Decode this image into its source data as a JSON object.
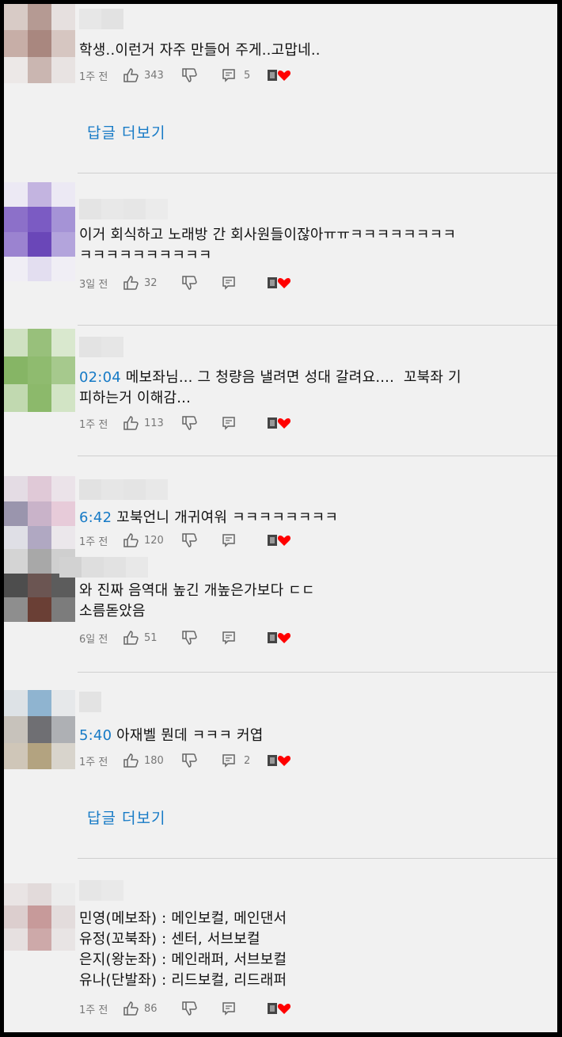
{
  "comments": [
    {
      "text": "학생..이런거 자주 만들어 주게..고맙네..",
      "time": "1주 전",
      "likes": "343",
      "replies": "5",
      "more_replies": "답글 더보기"
    },
    {
      "text": "이거 회식하고 노래방 간 회사원들이잖아ㅠㅠㅋㅋㅋㅋㅋㅋㅋㅋ\nㅋㅋㅋㅋㅋㅋㅋㅋㅋㅋ",
      "time": "3일 전",
      "likes": "32"
    },
    {
      "timestamp": "02:04",
      "text": " 메보좌님... 그 청량음 낼려면 성대 갈려요....  꼬북좌 기\n피하는거 이해감...",
      "time": "1주 전",
      "likes": "113"
    },
    {
      "timestamp": "6:42",
      "text": " 꼬북언니 개귀여워 ㅋㅋㅋㅋㅋㅋㅋㅋ",
      "time": "1주 전",
      "likes": "120"
    },
    {
      "text": "와 진짜 음역대 높긴 개높은가보다 ㄷㄷ\n소름돋았음",
      "time": "6일 전",
      "likes": "51"
    },
    {
      "timestamp": "5:40",
      "text": " 아재벨 뭔데 ㅋㅋㅋ 커엽",
      "time": "1주 전",
      "likes": "180",
      "replies": "2",
      "more_replies": "답글 더보기"
    },
    {
      "text": "민영(메보좌) : 메인보컬, 메인댄서\n유정(꼬북좌) : 센터, 서브보컬\n은지(왕눈좌) : 메인래퍼, 서브보컬\n유나(단발좌) : 리드보컬, 리드래퍼",
      "time": "1주 전",
      "likes": "86"
    }
  ],
  "colors": {
    "link": "#167ac6",
    "heart": "#ff0000",
    "background": "#f1f1f1"
  },
  "icons": [
    "thumb-up-icon",
    "thumb-down-icon",
    "reply-icon",
    "creator-heart-icon"
  ]
}
